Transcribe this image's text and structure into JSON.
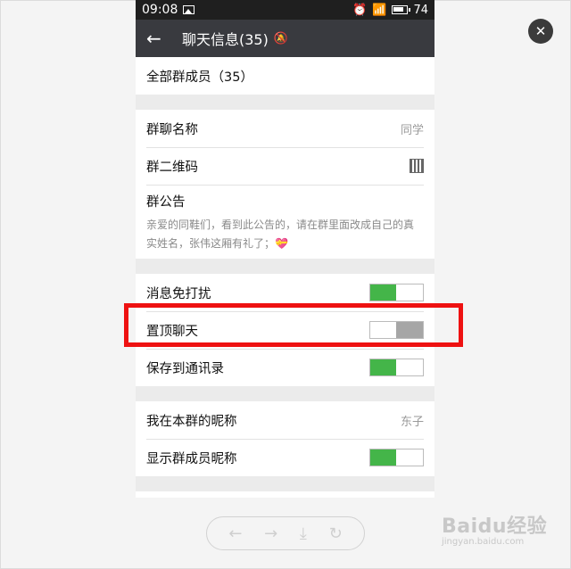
{
  "status_bar": {
    "time": "09:08",
    "battery": "74"
  },
  "nav": {
    "title": "聊天信息(35)"
  },
  "members": {
    "label": "全部群成员（35）"
  },
  "group_info": {
    "name_label": "群聊名称",
    "name_value": "同学",
    "qr_label": "群二维码",
    "notice_label": "群公告",
    "notice_text": "亲爱的同鞋们，看到此公告的，请在群里面改成自己的真实姓名，张伟这厢有礼了；💝"
  },
  "settings": {
    "mute_label": "消息免打扰",
    "mute_on": true,
    "pin_label": "置顶聊天",
    "pin_on": false,
    "save_label": "保存到通讯录",
    "save_on": true
  },
  "nickname": {
    "my_label": "我在本群的昵称",
    "my_value": "东子",
    "show_label": "显示群成员昵称",
    "show_on": true
  },
  "watermark": {
    "brand": "Baidu经验",
    "site": "jingyan.baidu.com"
  },
  "icons": {
    "close": "close-icon",
    "back": "back-arrow-icon",
    "mute": "bell-off-icon",
    "qr": "qr-code-icon",
    "prev": "arrow-left-icon",
    "next": "arrow-right-icon",
    "download": "download-icon",
    "rotate": "rotate-icon"
  },
  "colors": {
    "toggle_on": "#44b549",
    "toggle_off": "#a6a6a6",
    "highlight": "#ee1111",
    "nav_bg": "#393a3f"
  }
}
